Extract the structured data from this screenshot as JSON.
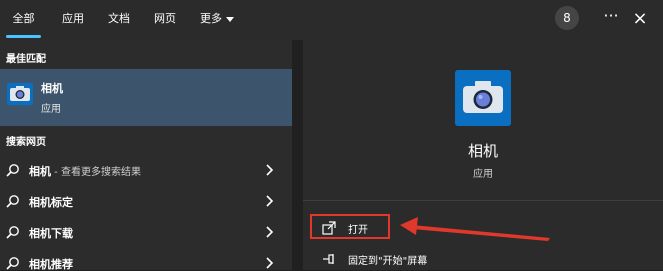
{
  "tabs": [
    {
      "label": "全部",
      "active": true
    },
    {
      "label": "应用"
    },
    {
      "label": "文档"
    },
    {
      "label": "网页"
    },
    {
      "label": "更多"
    }
  ],
  "toolbar": {
    "badge": "8",
    "more_options": "···",
    "close": "×"
  },
  "best_match": {
    "section_title": "最佳匹配",
    "name": "相机",
    "type": "应用",
    "icon": "camera-icon"
  },
  "web_search": {
    "section_title": "搜索网页",
    "items": [
      {
        "bold": "相机",
        "sub": " - 查看更多搜索结果"
      },
      {
        "bold": "相机标定",
        "sub": ""
      },
      {
        "bold": "相机下载",
        "sub": ""
      },
      {
        "bold": "相机推荐",
        "sub": ""
      }
    ]
  },
  "detail": {
    "title": "相机",
    "type": "应用",
    "actions": [
      {
        "label": "打开",
        "icon": "open-icon"
      },
      {
        "label": "固定到\"开始\"屏幕",
        "icon": "pin-icon"
      }
    ]
  },
  "colors": {
    "accent": "#4cc2ff",
    "selection": "#3c546c",
    "annotation": "#e0392b",
    "camera_tile": "#0a6fc1"
  }
}
